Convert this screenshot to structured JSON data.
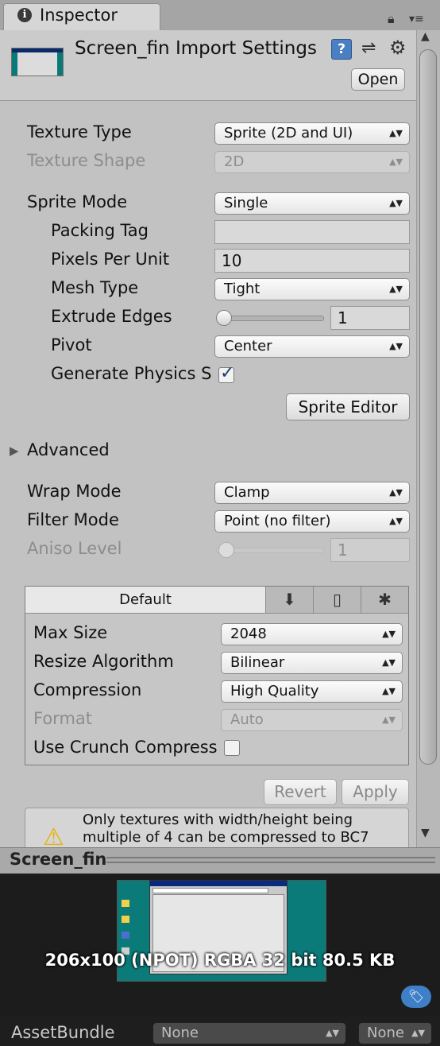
{
  "tab": {
    "icon": "i",
    "label": "Inspector"
  },
  "header": {
    "title": "Screen_fin Import Settings",
    "help": "?",
    "open_label": "Open"
  },
  "texture": {
    "type_label": "Texture Type",
    "type_value": "Sprite (2D and UI)",
    "shape_label": "Texture Shape",
    "shape_value": "2D",
    "sprite_mode_label": "Sprite Mode",
    "sprite_mode_value": "Single",
    "packing_tag_label": "Packing Tag",
    "packing_tag_value": "",
    "ppu_label": "Pixels Per Unit",
    "ppu_value": "10",
    "mesh_type_label": "Mesh Type",
    "mesh_type_value": "Tight",
    "extrude_label": "Extrude Edges",
    "extrude_value": "1",
    "pivot_label": "Pivot",
    "pivot_value": "Center",
    "physics_label": "Generate Physics Sh",
    "physics_checked": true,
    "sprite_editor_label": "Sprite Editor",
    "advanced_label": "Advanced",
    "wrap_label": "Wrap Mode",
    "wrap_value": "Clamp",
    "filter_label": "Filter Mode",
    "filter_value": "Point (no filter)",
    "aniso_label": "Aniso Level",
    "aniso_value": "1"
  },
  "platform": {
    "default_tab": "Default",
    "max_size_label": "Max Size",
    "max_size_value": "2048",
    "resize_label": "Resize Algorithm",
    "resize_value": "Bilinear",
    "compression_label": "Compression",
    "compression_value": "High Quality",
    "format_label": "Format",
    "format_value": "Auto",
    "crunch_label": "Use Crunch Compress",
    "crunch_checked": false
  },
  "actions": {
    "revert_label": "Revert",
    "apply_label": "Apply"
  },
  "warning": {
    "text": "Only textures with width/height being multiple of 4 can be compressed to BC7"
  },
  "preview": {
    "title": "Screen_fin",
    "info": "206x100 (NPOT)  RGBA 32 bit   80.5 KB"
  },
  "asset_bundle": {
    "label": "AssetBundle",
    "name_value": "None",
    "variant_value": "None"
  },
  "colors": {
    "accent": "#3e7fc8",
    "warning": "#e7b400",
    "background": "#c2c2c2"
  }
}
